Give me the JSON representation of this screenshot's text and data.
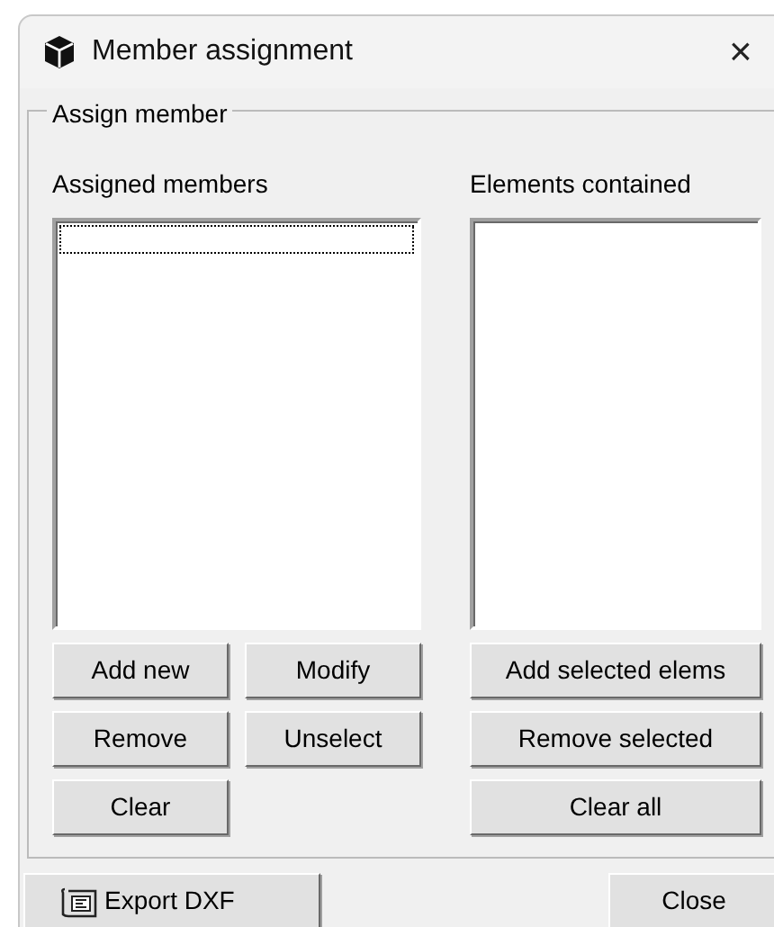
{
  "window": {
    "title": "Member assignment",
    "close": "×"
  },
  "group": {
    "title": "Assign member",
    "left": {
      "label": "Assigned members",
      "buttons": [
        [
          "Add new",
          "Modify"
        ],
        [
          "Remove",
          "Unselect"
        ],
        [
          "Clear"
        ]
      ]
    },
    "right": {
      "label": "Elements contained",
      "buttons": [
        "Add selected elems",
        "Remove selected",
        "Clear all"
      ]
    }
  },
  "footer": {
    "export": "Export DXF",
    "close": "Close"
  }
}
